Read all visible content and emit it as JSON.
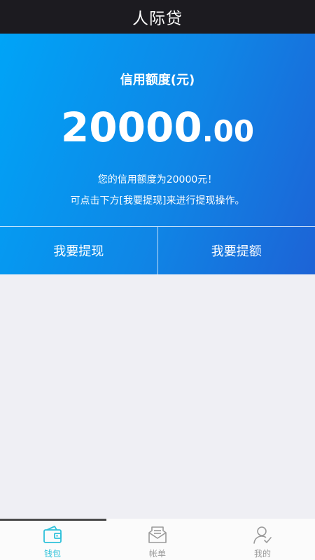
{
  "header": {
    "title": "人际贷"
  },
  "credit": {
    "label": "信用额度(元)",
    "amount_int": "20000",
    "amount_dec": ".00",
    "notice_line1": "您的信用额度为20000元！",
    "notice_line2": "可点击下方[我要提现]来进行提现操作。"
  },
  "actions": {
    "withdraw_label": "我要提现",
    "raise_limit_label": "我要提额"
  },
  "tabs": [
    {
      "label": "钱包",
      "icon": "wallet-icon",
      "active": true
    },
    {
      "label": "帐单",
      "icon": "bill-icon",
      "active": false
    },
    {
      "label": "我的",
      "icon": "user-icon",
      "active": false
    }
  ],
  "colors": {
    "header_bg": "#1c1b20",
    "hero_gradient_start": "#00a4f7",
    "hero_gradient_end": "#1d63d6",
    "tab_active": "#2ec1da",
    "tab_inactive": "#9a9a9a",
    "page_bg": "#efeff4"
  }
}
